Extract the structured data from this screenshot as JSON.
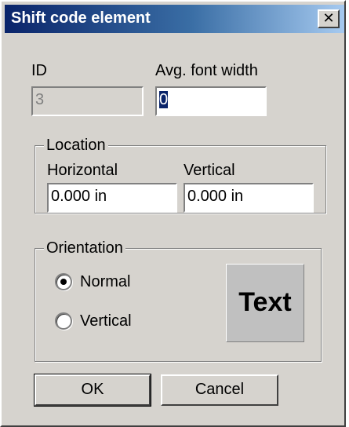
{
  "window": {
    "title": "Shift code element",
    "close_glyph": "✕"
  },
  "id_field": {
    "label": "ID",
    "value": "3"
  },
  "font_width": {
    "label": "Avg. font width",
    "value": "0"
  },
  "location": {
    "legend": "Location",
    "horizontal_label": "Horizontal",
    "horizontal_value": "0.000 in",
    "vertical_label": "Vertical",
    "vertical_value": "0.000 in"
  },
  "orientation": {
    "legend": "Orientation",
    "options": [
      {
        "label": "Normal",
        "selected": true
      },
      {
        "label": "Vertical",
        "selected": false
      }
    ],
    "preview_text": "Text"
  },
  "buttons": {
    "ok": "OK",
    "cancel": "Cancel"
  }
}
